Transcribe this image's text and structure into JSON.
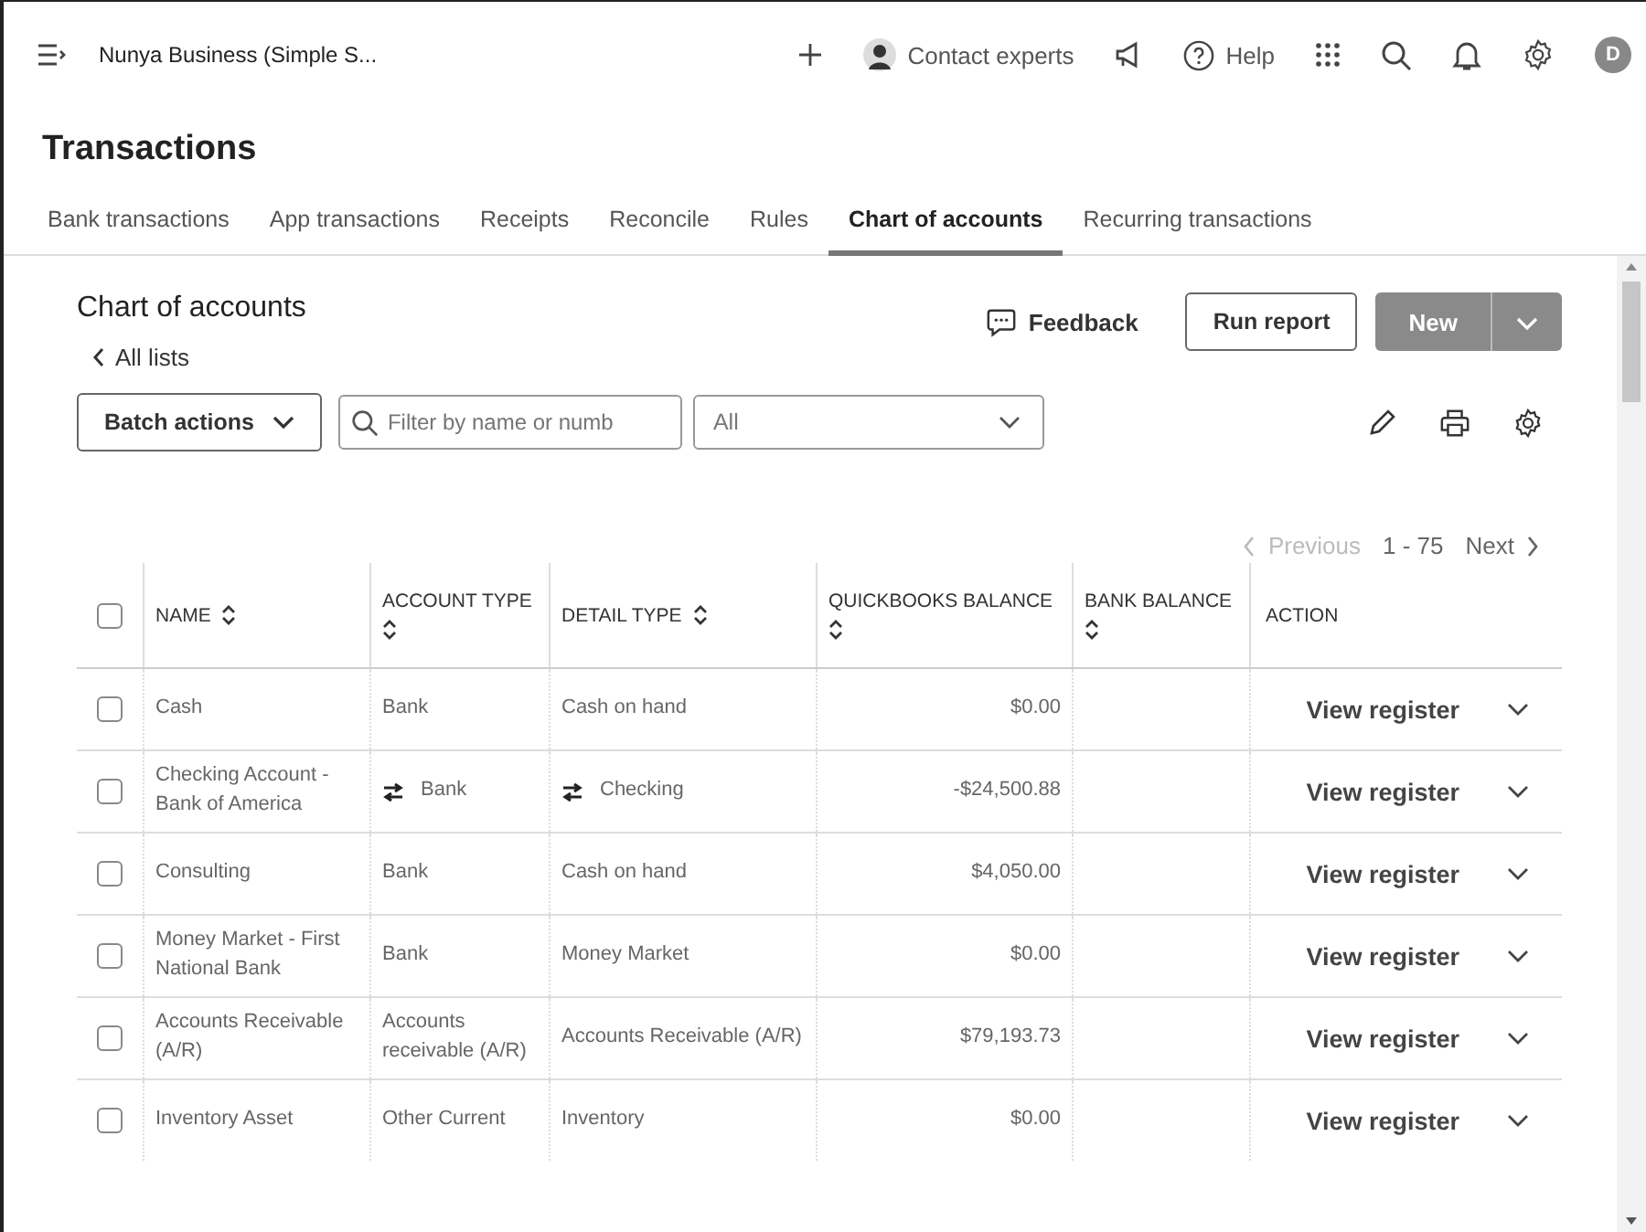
{
  "topbar": {
    "company": "Nunya Business (Simple S...",
    "contact": "Contact experts",
    "help": "Help",
    "avatar": "D"
  },
  "page_title": "Transactions",
  "tabs": [
    {
      "label": "Bank transactions",
      "selected": false
    },
    {
      "label": "App transactions",
      "selected": false
    },
    {
      "label": "Receipts",
      "selected": false
    },
    {
      "label": "Reconcile",
      "selected": false
    },
    {
      "label": "Rules",
      "selected": false
    },
    {
      "label": "Chart of accounts",
      "selected": true
    },
    {
      "label": "Recurring transactions",
      "selected": false
    }
  ],
  "panel": {
    "title": "Chart of accounts",
    "back_link": "All lists",
    "feedback": "Feedback",
    "run_report": "Run report",
    "new": "New"
  },
  "toolbar": {
    "batch_actions": "Batch actions",
    "filter": {
      "placeholder": "Filter by name or numb"
    },
    "type_select": "All"
  },
  "pagination": {
    "previous": "Previous",
    "range": "1 - 75",
    "next": "Next",
    "previous_disabled": true
  },
  "table": {
    "select_all_checked": false,
    "columns": [
      {
        "label": "NAME",
        "sortable": true
      },
      {
        "label": "ACCOUNT TYPE",
        "sortable": true
      },
      {
        "label": "DETAIL TYPE",
        "sortable": true
      },
      {
        "label": "QUICKBOOKS BALANCE",
        "sortable": true
      },
      {
        "label": "BANK BALANCE",
        "sortable": true
      },
      {
        "label": "ACTION",
        "sortable": false
      }
    ],
    "rows": [
      {
        "checked": false,
        "name": "Cash",
        "account_type": "Bank",
        "detail_type": "Cash on hand",
        "balance": "$0.00",
        "linked": false,
        "action": "View register"
      },
      {
        "checked": false,
        "name": "Checking Account - Bank of America",
        "account_type": "Bank",
        "detail_type": "Checking",
        "balance": "-$24,500.88",
        "linked": true,
        "action": "View register"
      },
      {
        "checked": false,
        "name": "Consulting",
        "account_type": "Bank",
        "detail_type": "Cash on hand",
        "balance": "$4,050.00",
        "linked": false,
        "action": "View register"
      },
      {
        "checked": false,
        "name": "Money Market - First National Bank",
        "account_type": "Bank",
        "detail_type": "Money Market",
        "balance": "$0.00",
        "linked": false,
        "action": "View register"
      },
      {
        "checked": false,
        "name": "Accounts Receivable (A/R)",
        "account_type": "Accounts receivable (A/R)",
        "detail_type": "Accounts Receivable (A/R)",
        "balance": "$79,193.73",
        "linked": false,
        "action": "View register"
      },
      {
        "checked": false,
        "name": "Inventory Asset",
        "account_type": "Other Current",
        "detail_type": "Inventory",
        "balance": "$0.00",
        "linked": false,
        "action": "View register"
      }
    ]
  }
}
